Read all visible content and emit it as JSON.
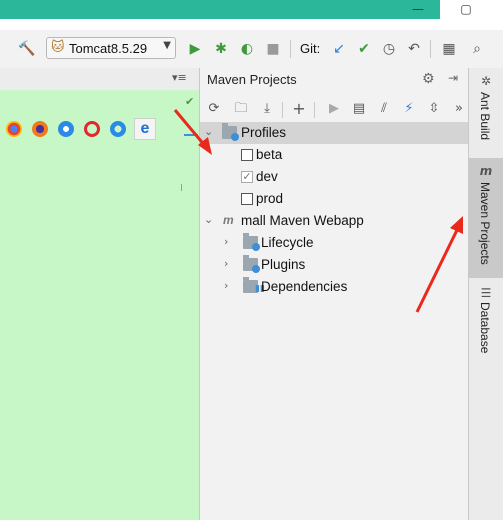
{
  "toolbar": {
    "run_config": "Tomcat8.5.29",
    "git_label": "Git:"
  },
  "maven": {
    "title": "Maven Projects",
    "tree": {
      "profiles_label": "Profiles",
      "profiles": [
        {
          "label": "beta",
          "checked": false
        },
        {
          "label": "dev",
          "checked": true
        },
        {
          "label": "prod",
          "checked": false
        }
      ],
      "project_label": "mall Maven Webapp",
      "children": [
        {
          "label": "Lifecycle"
        },
        {
          "label": "Plugins"
        },
        {
          "label": "Dependencies"
        }
      ]
    }
  },
  "side_strip": {
    "tabs": [
      "Ant Build",
      "Maven Projects",
      "Database"
    ]
  },
  "colors": {
    "accent_green": "#2ab79a",
    "editor_bg": "#c7f6c7",
    "annotation_red": "#e8291c",
    "selection": "#d4d4d4"
  }
}
